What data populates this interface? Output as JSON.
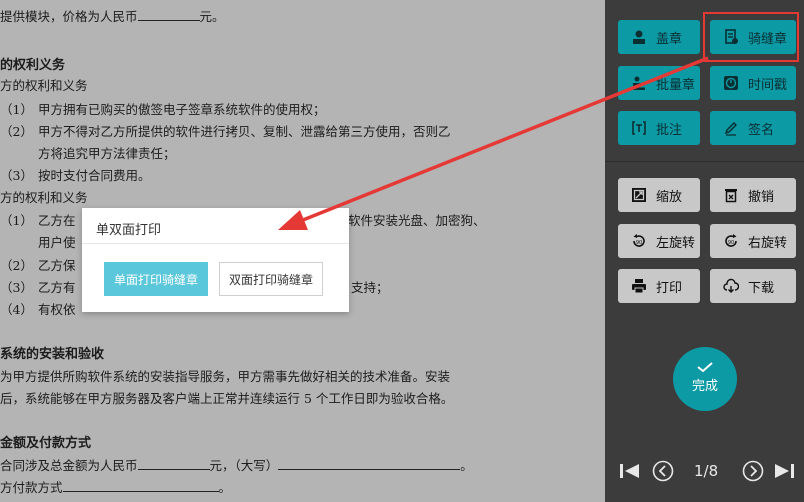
{
  "document": {
    "lines": [
      {
        "text": "提供模块，价格为人民币",
        "after": "元。",
        "blank": true,
        "head": false
      },
      {
        "text": "的权利义务",
        "head": true
      },
      {
        "text": "方的权利和义务",
        "head": false
      },
      {
        "num": "（1）",
        "text": "甲方拥有已购买的傲签电子签章系统软件的使用权；"
      },
      {
        "num": "（2）",
        "text": "甲方不得对乙方所提供的软件进行拷贝、复制、泄露给第三方使用，否则乙"
      },
      {
        "num": "",
        "text": "方将追究甲方法律责任；"
      },
      {
        "num": "（3）",
        "text": "按时支付合同费用。"
      },
      {
        "text": "方的权利和义务",
        "head": false
      },
      {
        "num": "（1）",
        "text": "乙方在",
        "tail": "软件安装光盘、加密狗、"
      },
      {
        "num": "",
        "text": "用户使"
      },
      {
        "num": "（2）",
        "text": "乙方保"
      },
      {
        "num": "（3）",
        "text": "乙方有",
        "tail": "支持；"
      },
      {
        "num": "（4）",
        "text": "有权依"
      },
      {
        "text": "系统的安装和验收",
        "head": true
      },
      {
        "text": "为甲方提供所购软件系统的安装指导服务，甲方需事先做好相关的技术准备。安装"
      },
      {
        "text": "后，系统能够在甲方服务器及客户端上正常并连续运行 5 个工作日即为验收合格。"
      },
      {
        "text": "金额及付款方式",
        "head": true
      },
      {
        "text": "合同涉及总金额为人民币",
        "mid": "元，（大写）",
        "end": "。"
      },
      {
        "text": "方付款方式",
        "end": "。"
      }
    ]
  },
  "modal": {
    "title": "单双面打印",
    "primary_label": "单面打印骑缝章",
    "secondary_label": "双面打印骑缝章"
  },
  "panel": {
    "buttons": [
      {
        "id": "stamp",
        "label": "盖章",
        "icon": "user-stamp-icon"
      },
      {
        "id": "seam",
        "label": "骑缝章",
        "icon": "seam-seal-icon"
      },
      {
        "id": "batch",
        "label": "批量章",
        "icon": "batch-stamp-icon"
      },
      {
        "id": "timestamp",
        "label": "时间戳",
        "icon": "clock-icon"
      },
      {
        "id": "annotate",
        "label": "批注",
        "icon": "text-bracket-icon"
      },
      {
        "id": "sign",
        "label": "签名",
        "icon": "pen-icon"
      },
      {
        "id": "zoom",
        "label": "缩放",
        "icon": "zoom-icon"
      },
      {
        "id": "undo",
        "label": "撤销",
        "icon": "trash-icon"
      },
      {
        "id": "rotate_left",
        "label": "左旋转",
        "icon": "rotate-left-icon"
      },
      {
        "id": "rotate_right",
        "label": "右旋转",
        "icon": "rotate-right-icon"
      },
      {
        "id": "print",
        "label": "打印",
        "icon": "printer-icon"
      },
      {
        "id": "download",
        "label": "下载",
        "icon": "cloud-download-icon"
      }
    ],
    "done_label": "完成",
    "page_indicator": "1/8"
  },
  "colors": {
    "teal": "#0c9aa5",
    "panel_bg": "#3c3c3c",
    "highlight": "#e53935",
    "modal_primary": "#5bc7da"
  }
}
